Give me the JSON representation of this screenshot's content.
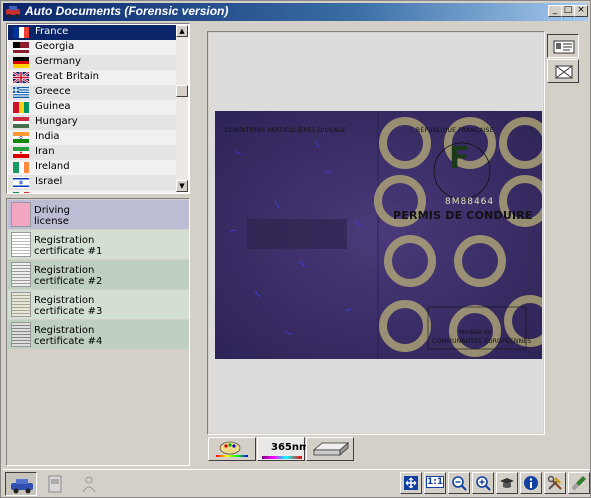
{
  "window": {
    "title": "Auto Documents (Forensic version)",
    "controls": {
      "minimize": "_",
      "maximize": "□",
      "close": "×"
    }
  },
  "countries": [
    {
      "label": "France",
      "selected": true,
      "flag": "france"
    },
    {
      "label": "Georgia",
      "flag": "georgia"
    },
    {
      "label": "Germany",
      "flag": "germany"
    },
    {
      "label": "Great Britain",
      "flag": "great-britain"
    },
    {
      "label": "Greece",
      "flag": "greece"
    },
    {
      "label": "Guinea",
      "flag": "guinea"
    },
    {
      "label": "Hungary",
      "flag": "hungary"
    },
    {
      "label": "India",
      "flag": "india"
    },
    {
      "label": "Iran",
      "flag": "iran"
    },
    {
      "label": "Ireland",
      "flag": "ireland"
    },
    {
      "label": "Israel",
      "flag": "israel"
    }
  ],
  "documents": [
    {
      "line1": "Driving",
      "line2": "license",
      "selected": true
    },
    {
      "line1": "Registration",
      "line2": "certificate #1"
    },
    {
      "line1": "Registration",
      "line2": "certificate #2"
    },
    {
      "line1": "Registration",
      "line2": "certificate #3"
    },
    {
      "line1": "Registration",
      "line2": "certificate #4"
    }
  ],
  "document_image": {
    "header_left": "CONDITIONS PARTICULIÈRES D'USAGE",
    "header_right": "RÉPUBLIQUE FRANÇAISE",
    "emblem_letter": "F",
    "serial": "8M88464",
    "title": "PERMIS DE CONDUIRE",
    "footer_1": "Modèle de",
    "footer_2": "COMMUNAUTÉS EUROPÉENNES"
  },
  "lighting_tabs": [
    {
      "name": "visible-light",
      "label": ""
    },
    {
      "name": "uv-365nm",
      "label": "365nm",
      "active": true
    },
    {
      "name": "infrared",
      "label": ""
    }
  ],
  "bottom_tools": {
    "actual_size": "1:1"
  },
  "colors": {
    "selection": "#0a246a",
    "doc_background": "#3a2b66",
    "hologram": "#b9b077"
  }
}
